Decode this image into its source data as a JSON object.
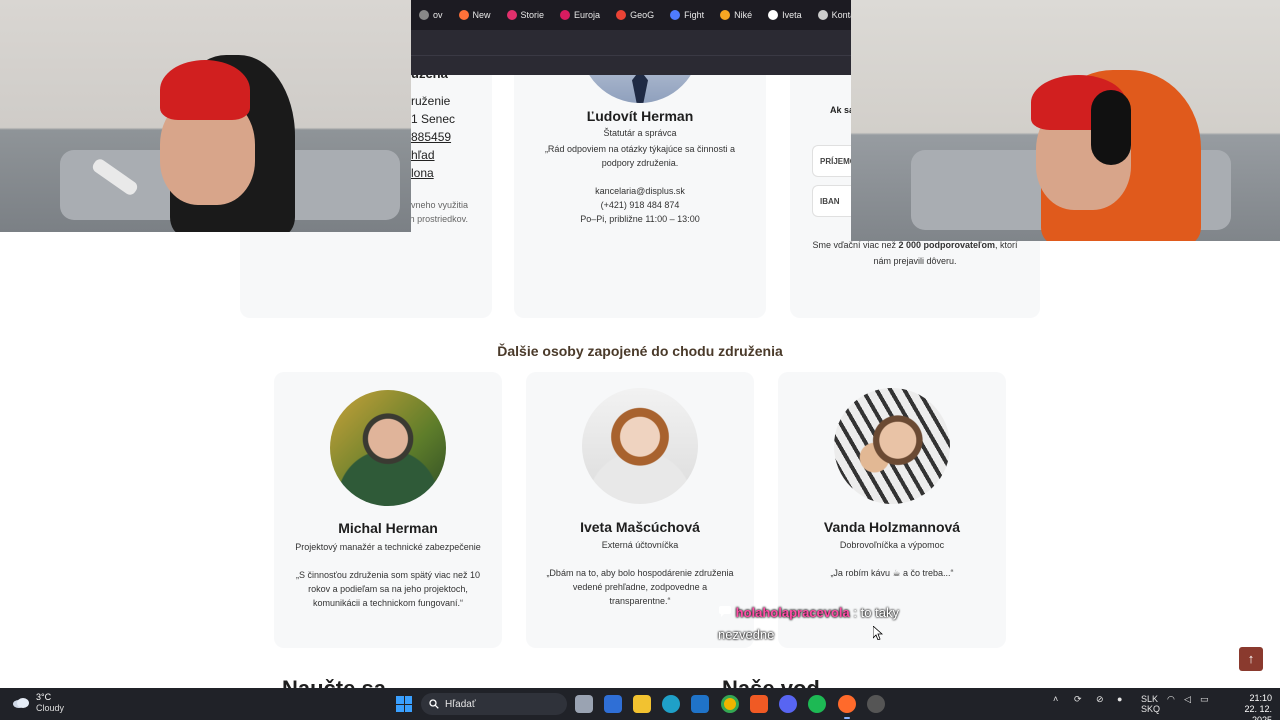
{
  "browser_tabs": [
    {
      "label": "ov",
      "icon": "generic-icon",
      "color": "#888888"
    },
    {
      "label": "New",
      "icon": "firefox-icon",
      "color": "#ff7139"
    },
    {
      "label": "Storie",
      "icon": "instagram-icon",
      "color": "#e1306c"
    },
    {
      "label": "Euroja",
      "icon": "eurojackpot-icon",
      "color": "#d81b60"
    },
    {
      "label": "GeoG",
      "icon": "map-pin-icon",
      "color": "#ea4335"
    },
    {
      "label": "Fight",
      "icon": "v-icon",
      "color": "#4f7cff"
    },
    {
      "label": "Niké",
      "icon": "nike-icon",
      "color": "#f5a623"
    },
    {
      "label": "Iveta",
      "icon": "google-icon",
      "color": "#ffffff"
    },
    {
      "label": "Konta",
      "icon": "paw-icon",
      "color": "#cccccc"
    }
  ],
  "left_card": {
    "heading": "užena",
    "lines": [
      "ruženie",
      "1 Senec",
      "885459",
      "hľad",
      "lona"
    ],
    "note": "ov využívania ov, s cieľom efektívneho využitia finančných prostriedkov."
  },
  "herman": {
    "name": "Ľudovít Herman",
    "role": "Štatutár a správca",
    "quote": "„Rád odpoviem na otázky týkajúce sa činnosti a podpory združenia.",
    "email": "kancelaria@displus.sk",
    "phone": "(+421) 918 484 874",
    "hours": "Po–Pi, približne 11:00 – 13:00"
  },
  "donate": {
    "question": "Ak sa",
    "field_recipient": "PRÍJEMC",
    "field_iban": "IBAN",
    "supporters_pre": "Sme vďační viac než",
    "supporters_bold": "2 000 podporovateľom",
    "supporters_post": ", ktorí nám prejavili dôveru."
  },
  "section_title": "Ďalšie osoby zapojené do chodu združenia",
  "people": [
    {
      "name": "Michal Herman",
      "role": "Projektový manažér a technické zabezpečenie",
      "quote": "„S činnosťou združenia som spätý viac než 10 rokov a podieľam sa na jeho projektoch, komunikácii a technickom fungovaní.“"
    },
    {
      "name": "Iveta Mašcúchová",
      "role": "Externá účtovníčka",
      "quote": "„Dbám na to, aby bolo hospodárenie združenia vedené prehľadne, zodpovedne a transparentne.“"
    },
    {
      "name": "Vanda Holzmannová",
      "role": "Dobrovoľníčka a výpomoc",
      "quote": "„Ja robím kávu ☕ a čo treba...“"
    }
  ],
  "bottom_headings": [
    "Naučte sa",
    "Naše  vod"
  ],
  "chat": {
    "user": "holaholapracevola",
    "message": "to taky nezvedne"
  },
  "taskbar": {
    "temperature": "3°C",
    "condition": "Cloudy",
    "search_placeholder": "Hľadať",
    "lang_top": "SLK",
    "lang_bottom": "SKQ",
    "time": "21:10",
    "date": "22. 12. 2025"
  },
  "colors": {
    "accent": "#8a3a2e",
    "heading_brown": "#4a3a2a",
    "chat_user": "#ff4da6"
  }
}
